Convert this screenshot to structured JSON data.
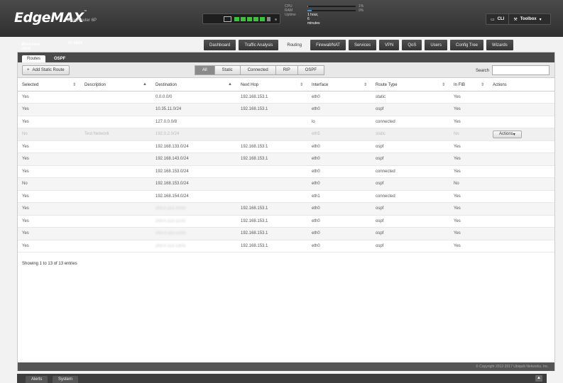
{
  "header": {
    "logo": "EdgeMAX",
    "model": "EdgeRouter 6P",
    "stats": {
      "cpu_label": "CPU",
      "cpu_pct": "1%",
      "cpu_level": 0.01,
      "ram_label": "RAM",
      "ram_pct": "9%",
      "ram_level": 0.09,
      "uptime_label": "Uptime",
      "uptime_value": "1 hour, 6 minutes"
    },
    "cli_label": "CLI",
    "toolbox_label": "Toolbox"
  },
  "welcome": {
    "user_label": "Welcome ubnt",
    "to_label": "to ubnt"
  },
  "nav": [
    "Dashboard",
    "Traffic Analysis",
    "Routing",
    "Firewall/NAT",
    "Services",
    "VPN",
    "QoS",
    "Users",
    "Config Tree",
    "Wizards"
  ],
  "nav_active": "Routing",
  "subtabs": [
    "Routes",
    "OSPF"
  ],
  "toolbar": {
    "add_label": "Add Static Route",
    "filters": [
      "All",
      "Static",
      "Connected",
      "RIP",
      "OSPF"
    ],
    "search_label": "Search",
    "search_value": ""
  },
  "table": {
    "headers": [
      "Selected",
      "Description",
      "Destination",
      "Next Hop",
      "Interface",
      "Route Type",
      "In FIB",
      "Actions"
    ],
    "rows": [
      [
        "Yes",
        "",
        "0.0.0.0/0",
        "192.168.153.1",
        "eth0",
        "static",
        "Yes",
        ""
      ],
      [
        "Yes",
        "",
        "10.35.11.0/24",
        "192.168.153.1",
        "eth0",
        "ospf",
        "Yes",
        ""
      ],
      [
        "Yes",
        "",
        "127.0.0.0/8",
        "",
        "lo",
        "connected",
        "Yes",
        ""
      ],
      [
        "No",
        "Test Network",
        "192.0.2.0/24",
        "",
        "eth5",
        "static",
        "No",
        "Actions"
      ],
      [
        "Yes",
        "",
        "192.168.133.0/24",
        "192.168.153.1",
        "eth0",
        "ospf",
        "Yes",
        ""
      ],
      [
        "Yes",
        "",
        "192.168.143.0/24",
        "192.168.153.1",
        "eth0",
        "ospf",
        "Yes",
        ""
      ],
      [
        "Yes",
        "",
        "192.168.153.0/24",
        "",
        "eth0",
        "connected",
        "Yes",
        ""
      ],
      [
        "No",
        "",
        "192.168.153.0/24",
        "",
        "eth0",
        "ospf",
        "No",
        ""
      ],
      [
        "Yes",
        "",
        "192.168.154.0/24",
        "",
        "eth1",
        "connected",
        "Yes",
        ""
      ],
      [
        "Yes",
        "",
        "203.0.113.10/32",
        "192.168.153.1",
        "eth0",
        "ospf",
        "Yes",
        ""
      ],
      [
        "Yes",
        "",
        "203.0.113.11/32",
        "192.168.153.1",
        "eth0",
        "ospf",
        "Yes",
        ""
      ],
      [
        "Yes",
        "",
        "203.0.113.12/32",
        "192.168.153.1",
        "eth0",
        "ospf",
        "Yes",
        ""
      ],
      [
        "Yes",
        "",
        "203.0.113.13/32",
        "192.168.153.1",
        "eth0",
        "ospf",
        "Yes",
        ""
      ]
    ]
  },
  "summary": "Showing 1 to 13 of 13 entries",
  "copyright": "© Copyright 2012-2017 Ubiquiti Networks, Inc.",
  "bottom_tabs": [
    "Alerts",
    "System"
  ]
}
